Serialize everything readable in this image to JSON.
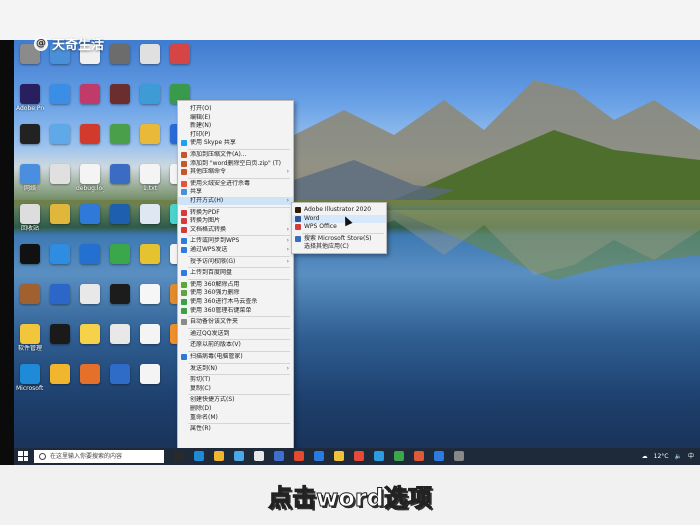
{
  "watermark": {
    "text": "天奇生活",
    "logo_glyph": "@"
  },
  "subtitle": "点击word选项",
  "desktop_icons": [
    {
      "label": "",
      "color": "#8b8b8b"
    },
    {
      "label": "",
      "color": "#4a90d9"
    },
    {
      "label": "",
      "color": "#f0f0f0"
    },
    {
      "label": "",
      "color": "#6c6c6c"
    },
    {
      "label": "",
      "color": "#e0e0e0"
    },
    {
      "label": "",
      "color": "#d64545"
    },
    {
      "label": "Adobe Premie...",
      "color": "#2a1f5e"
    },
    {
      "label": "",
      "color": "#3a8ee6"
    },
    {
      "label": "",
      "color": "#c03a6a"
    },
    {
      "label": "",
      "color": "#6b2d2d"
    },
    {
      "label": "",
      "color": "#3f9bd6"
    },
    {
      "label": "",
      "color": "#3a9a4b"
    },
    {
      "label": "",
      "color": "#222"
    },
    {
      "label": "",
      "color": "#5fa9e8"
    },
    {
      "label": "",
      "color": "#d23b2b"
    },
    {
      "label": "",
      "color": "#4aa04a"
    },
    {
      "label": "",
      "color": "#e9b93a"
    },
    {
      "label": "",
      "color": "#2a6ad6"
    },
    {
      "label": "网络",
      "color": "#4a8ee0"
    },
    {
      "label": "",
      "color": "#e0e0e0"
    },
    {
      "label": "debug.log",
      "color": "#f4f4f4"
    },
    {
      "label": "",
      "color": "#3b6cc4"
    },
    {
      "label": "1.txt",
      "color": "#f4f4f4"
    },
    {
      "label": "",
      "color": "#f4f4f4"
    },
    {
      "label": "回收站",
      "color": "#dddddd"
    },
    {
      "label": "",
      "color": "#e0b63c"
    },
    {
      "label": "",
      "color": "#2f7ad8"
    },
    {
      "label": "",
      "color": "#1e5fb0"
    },
    {
      "label": "",
      "color": "#dfe8f2"
    },
    {
      "label": "",
      "color": "#4ad3cc"
    },
    {
      "label": "",
      "color": "#111"
    },
    {
      "label": "",
      "color": "#2e8de0"
    },
    {
      "label": "",
      "color": "#2470d0"
    },
    {
      "label": "",
      "color": "#3aa84a"
    },
    {
      "label": "",
      "color": "#e5c230"
    },
    {
      "label": "",
      "color": "#f4f4f4"
    },
    {
      "label": "",
      "color": "#a06030"
    },
    {
      "label": "",
      "color": "#2d66c9"
    },
    {
      "label": "",
      "color": "#e8e8e8"
    },
    {
      "label": "",
      "color": "#1c1c1c"
    },
    {
      "label": "",
      "color": "#f6f6f6"
    },
    {
      "label": "",
      "color": "#e28b2a"
    },
    {
      "label": "软件管理",
      "color": "#f2c63a"
    },
    {
      "label": "",
      "color": "#1a1a1a"
    },
    {
      "label": "",
      "color": "#f6d24a"
    },
    {
      "label": "",
      "color": "#e8e8e8"
    },
    {
      "label": "",
      "color": "#f4f4f4"
    },
    {
      "label": "",
      "color": "#ef8f2a"
    },
    {
      "label": "Microsoft Edge",
      "color": "#1f8ad8"
    },
    {
      "label": "",
      "color": "#f2b52e"
    },
    {
      "label": "",
      "color": "#e4702a"
    },
    {
      "label": "",
      "color": "#2f6cc8"
    },
    {
      "label": "",
      "color": "#f4f4f4"
    }
  ],
  "context_menu": {
    "items": [
      {
        "label": "打开(O)",
        "icon": "",
        "arrow": false,
        "sep_after": false
      },
      {
        "label": "编辑(E)",
        "icon": "",
        "arrow": false,
        "sep_after": false
      },
      {
        "label": "新建(N)",
        "icon": "",
        "arrow": false,
        "sep_after": false
      },
      {
        "label": "打印(P)",
        "icon": "",
        "arrow": false,
        "sep_after": false
      },
      {
        "label": "使用 Skype 共享",
        "icon": "#1da1f2",
        "arrow": false,
        "sep_after": true
      },
      {
        "label": "添加到压缩文件(A)...",
        "icon": "#c7562c",
        "arrow": false,
        "sep_after": false
      },
      {
        "label": "添加到 \"word删除空白页.zip\" (T)",
        "icon": "#c7562c",
        "arrow": false,
        "sep_after": false
      },
      {
        "label": "其他压缩命令",
        "icon": "#c7562c",
        "arrow": true,
        "sep_after": true
      },
      {
        "label": "使用火绒安全进行杀毒",
        "icon": "#e5533a",
        "arrow": false,
        "sep_after": false
      },
      {
        "label": "共享",
        "icon": "#4a90d9",
        "arrow": false,
        "sep_after": false
      },
      {
        "label": "打开方式(H)",
        "icon": "",
        "arrow": true,
        "sep_after": true,
        "highlight": true
      },
      {
        "label": "转换为PDF",
        "icon": "#d63b3b",
        "arrow": false,
        "sep_after": false
      },
      {
        "label": "转换为图片",
        "icon": "#d63b3b",
        "arrow": false,
        "sep_after": false
      },
      {
        "label": "文档格式转换",
        "icon": "#d63b3b",
        "arrow": true,
        "sep_after": true
      },
      {
        "label": "上传或同步到WPS",
        "icon": "#2b7be0",
        "arrow": true,
        "sep_after": false
      },
      {
        "label": "通过WPS发送",
        "icon": "#2b7be0",
        "arrow": true,
        "sep_after": true
      },
      {
        "label": "授予访问权限(G)",
        "icon": "",
        "arrow": true,
        "sep_after": true
      },
      {
        "label": "上传到百度网盘",
        "icon": "#2f7be6",
        "arrow": false,
        "sep_after": true
      },
      {
        "label": "使用 360解除占用",
        "icon": "#5aa73a",
        "arrow": false,
        "sep_after": false
      },
      {
        "label": "使用 360强力删除",
        "icon": "#5aa73a",
        "arrow": false,
        "sep_after": false
      },
      {
        "label": "使用 360进行木马云查杀",
        "icon": "#3aa14a",
        "arrow": false,
        "sep_after": false
      },
      {
        "label": "使用 360管理右键菜单",
        "icon": "#3aa14a",
        "arrow": false,
        "sep_after": true
      },
      {
        "label": "自动备份该文件夹",
        "icon": "#8a8a8a",
        "arrow": false,
        "sep_after": true
      },
      {
        "label": "通过QQ发送到",
        "icon": "",
        "arrow": false,
        "sep_after": true
      },
      {
        "label": "还原以前的版本(V)",
        "icon": "",
        "arrow": false,
        "sep_after": true
      },
      {
        "label": "扫描病毒(电脑管家)",
        "icon": "#2a7ad8",
        "arrow": false,
        "sep_after": true
      },
      {
        "label": "发送到(N)",
        "icon": "",
        "arrow": true,
        "sep_after": true
      },
      {
        "label": "剪切(T)",
        "icon": "",
        "arrow": false,
        "sep_after": false
      },
      {
        "label": "复制(C)",
        "icon": "",
        "arrow": false,
        "sep_after": true
      },
      {
        "label": "创建快捷方式(S)",
        "icon": "",
        "arrow": false,
        "sep_after": false
      },
      {
        "label": "删除(D)",
        "icon": "",
        "arrow": false,
        "sep_after": false
      },
      {
        "label": "重命名(M)",
        "icon": "",
        "arrow": false,
        "sep_after": true
      },
      {
        "label": "属性(R)",
        "icon": "",
        "arrow": false,
        "sep_after": false
      }
    ]
  },
  "submenu": {
    "items": [
      {
        "label": "Adobe Illustrator 2020",
        "icon": "#2f1a00",
        "sep_after": false
      },
      {
        "label": "Word",
        "icon": "#2b579a",
        "sep_after": false,
        "highlight": true
      },
      {
        "label": "WPS Office",
        "icon": "#d63b3b",
        "sep_after": true
      },
      {
        "label": "搜索 Microsoft Store(S)",
        "icon": "#3a6cc4",
        "sep_after": false
      },
      {
        "label": "选择其他应用(C)",
        "icon": "",
        "sep_after": false
      }
    ]
  },
  "taskbar": {
    "search_placeholder": "在这里输入你要搜索的内容",
    "pinned_colors": [
      "#2a2a2a",
      "#1f8ad8",
      "#f2b52e",
      "#49a9e8",
      "#e8e8e8",
      "#3f6fd0",
      "#e64a2e",
      "#2a7be0",
      "#f0c23a",
      "#e84a3a",
      "#2a9de0",
      "#3aa84a",
      "#e05a3a",
      "#2b7be0",
      "#888888"
    ],
    "weather": "12°C",
    "language": "中"
  }
}
